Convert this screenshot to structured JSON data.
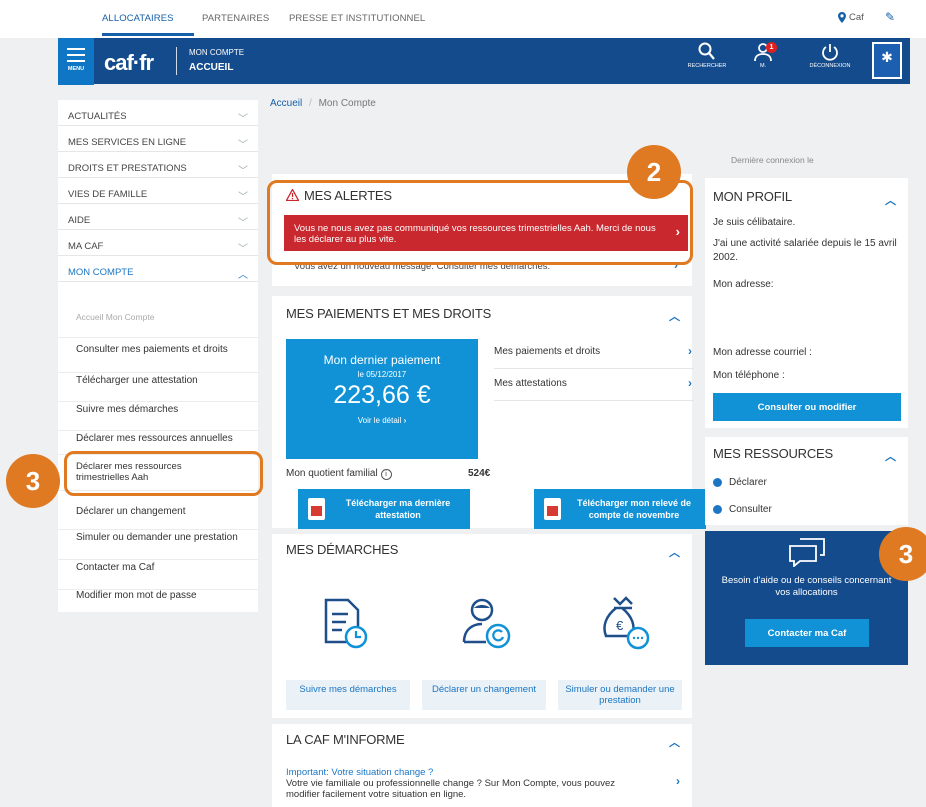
{
  "toplinks": {
    "allocataires": "ALLOCATAIRES",
    "partenaires": "PARTENAIRES",
    "presse": "PRESSE ET INSTITUTIONNEL",
    "location": "Caf"
  },
  "header": {
    "menu_label": "MENU",
    "logo": "caf·fr",
    "account_small": "MON COMPTE",
    "account_big": "ACCUEIL",
    "search_label": "RECHERCHER",
    "user_label": "M.",
    "notif_count": "1",
    "logout_label": "DÉCONNEXION"
  },
  "sidebar": {
    "sections": [
      {
        "label": "ACTUALITÉS"
      },
      {
        "label": "MES SERVICES EN LIGNE"
      },
      {
        "label": "DROITS ET PRESTATIONS"
      },
      {
        "label": "VIES DE FAMILLE"
      },
      {
        "label": "AIDE"
      },
      {
        "label": "MA CAF"
      },
      {
        "label": "MON COMPTE"
      }
    ],
    "subitems": [
      "Accueil Mon Compte",
      "Consulter mes paiements et droits",
      "Télécharger une attestation",
      "Suivre mes démarches",
      "Déclarer mes ressources annuelles",
      "Déclarer mes ressources trimestrielles Aah",
      "Déclarer un changement",
      "Simuler ou demander une prestation",
      "Contacter ma Caf",
      "Modifier mon mot de passe"
    ]
  },
  "breadcrumb": {
    "home": "Accueil",
    "sep": "/",
    "current": "Mon Compte"
  },
  "alerts": {
    "title": "MES ALERTES",
    "red_message": "Vous ne nous avez pas communiqué vos ressources trimestrielles Aah. Merci de nous les déclarer au plus vite.",
    "message": "Vous avez un nouveau message. Consulter mes démarches."
  },
  "payments": {
    "title": "MES PAIEMENTS ET MES DROITS",
    "last_label": "Mon dernier paiement",
    "last_date": "le 05/12/2017",
    "amount": "223,66 €",
    "detail_link": "Voir le détail",
    "links": [
      "Mes paiements et droits",
      "Mes attestations"
    ],
    "quotient_label": "Mon quotient familial",
    "quotient_value": "524€",
    "dl1": "Télécharger ma dernière attestation",
    "dl2": "Télécharger mon relevé de compte de novembre"
  },
  "demarches": {
    "title": "MES DÉMARCHES",
    "buttons": [
      "Suivre mes démarches",
      "Déclarer un changement",
      "Simuler ou demander une prestation"
    ]
  },
  "informe": {
    "title": "LA CAF M'INFORME",
    "headline": "Important: Votre situation change ?",
    "body": "Votre vie familiale ou professionnelle change ? Sur Mon Compte, vous pouvez modifier facilement votre situation en ligne."
  },
  "profile": {
    "last_connection": "Dernière connexion le",
    "title": "MON PROFIL",
    "lines": [
      "Je suis célibataire.",
      "J'ai une activité salariée depuis le 15 avril 2002.",
      "Mon adresse:"
    ],
    "email": "Mon adresse courriel :",
    "phone": "Mon téléphone :",
    "button": "Consulter ou modifier"
  },
  "ressources": {
    "title": "MES RESSOURCES",
    "items": [
      "Déclarer",
      "Consulter"
    ]
  },
  "help": {
    "text": "Besoin d'aide ou de conseils concernant vos allocations",
    "button": "Contacter ma Caf"
  },
  "annotations": {
    "badge_alert": "2",
    "badge_side": "3",
    "badge_help": "3"
  }
}
